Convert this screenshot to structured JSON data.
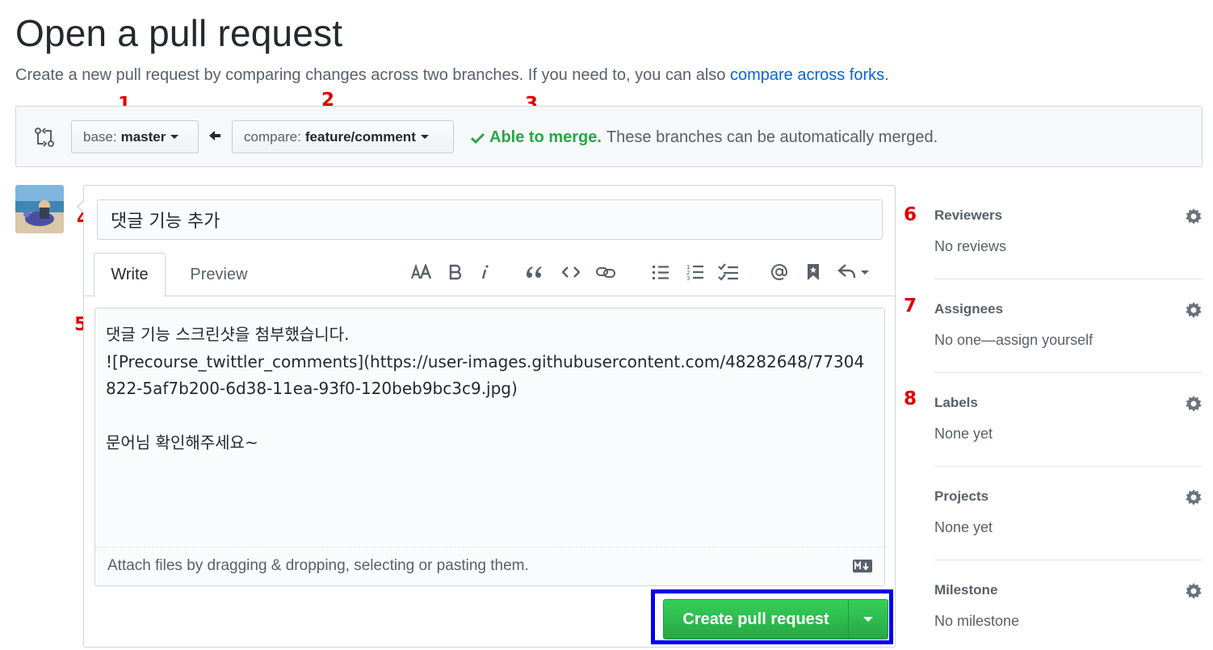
{
  "page": {
    "title": "Open a pull request",
    "description": "Create a new pull request by comparing changes across two branches. If you need to, you can also ",
    "description_link": "compare across forks",
    "description_end": "."
  },
  "annotations": [
    "1",
    "2",
    "3",
    "4",
    "5",
    "6",
    "7",
    "8"
  ],
  "branches": {
    "base_prefix": "base:",
    "base_name": "master",
    "compare_prefix": "compare:",
    "compare_name": "feature/comment",
    "merge_ok": "Able to merge.",
    "merge_text": "These branches can be automatically merged."
  },
  "form": {
    "title_value": "댓글 기능 추가",
    "tab_write": "Write",
    "tab_preview": "Preview",
    "toolbar_icons": [
      "text-size-icon",
      "bold-icon",
      "italic-icon",
      "quote-icon",
      "code-icon",
      "link-icon",
      "unordered-list-icon",
      "ordered-list-icon",
      "task-list-icon",
      "mention-icon",
      "bookmark-icon",
      "reply-icon"
    ],
    "body_value": "댓글 기능 스크린샷을 첨부했습니다.\n![Precourse_twittler_comments](https://user-images.githubusercontent.com/48282648/77304822-5af7b200-6d38-11ea-93f0-120beb9bc3c9.jpg)\n\n문어님 확인해주세요~",
    "attach_text": "Attach files by dragging & dropping, selecting or pasting them.",
    "submit_label": "Create pull request"
  },
  "sidebar": [
    {
      "heading": "Reviewers",
      "value": "No reviews"
    },
    {
      "heading": "Assignees",
      "value": "No one—assign yourself"
    },
    {
      "heading": "Labels",
      "value": "None yet"
    },
    {
      "heading": "Projects",
      "value": "None yet"
    },
    {
      "heading": "Milestone",
      "value": "No milestone"
    }
  ],
  "colors": {
    "accent_link": "#0366d6",
    "merge_green": "#28a745",
    "annotation_red": "#e00000",
    "highlight_blue": "#0000ee"
  }
}
